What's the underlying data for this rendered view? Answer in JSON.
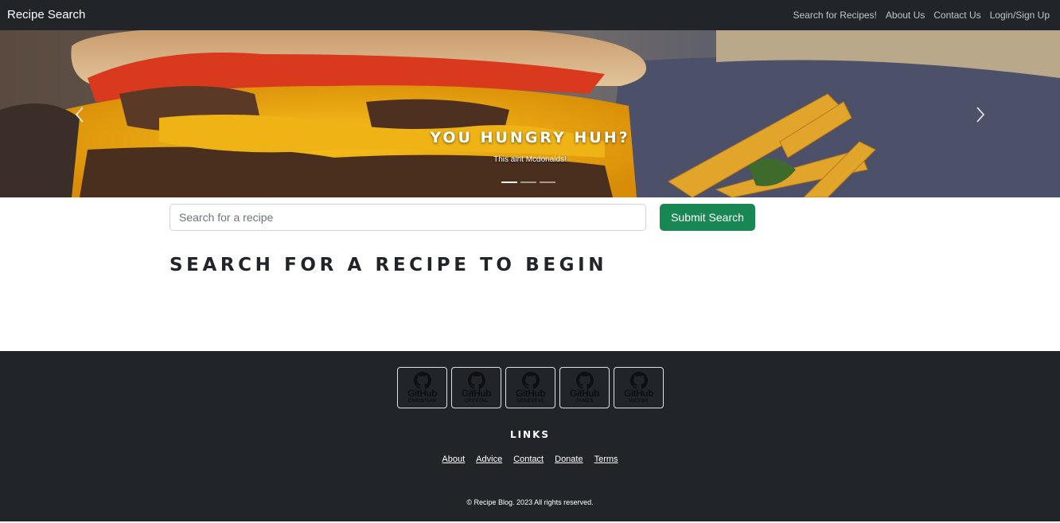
{
  "navbar": {
    "brand": "Recipe Search",
    "links": [
      {
        "label": "Search for Recipes!"
      },
      {
        "label": "About Us"
      },
      {
        "label": "Contact Us"
      },
      {
        "label": "Login/Sign Up"
      }
    ]
  },
  "carousel": {
    "caption_title": "YOU HUNGRY HUH?",
    "caption_subtitle": "This aint Mcdonalds!",
    "slides": 3,
    "active_slide": 1
  },
  "search": {
    "placeholder": "Search for a recipe",
    "value": "",
    "submit_label": "Submit Search",
    "submit_color": "#198754"
  },
  "main": {
    "heading": "SEARCH FOR A RECIPE TO BEGIN"
  },
  "footer": {
    "github_cards": [
      {
        "word": "GitHub",
        "name": "CHRISTIAN",
        "icon": "github-icon"
      },
      {
        "word": "GitHub",
        "name": "CRYSTAL",
        "icon": "github-icon"
      },
      {
        "word": "GitHub",
        "name": "GENEVEVE",
        "icon": "github-icon"
      },
      {
        "word": "GitHub",
        "name": "JAMES",
        "icon": "github-icon"
      },
      {
        "word": "GitHub",
        "name": "VICTOR",
        "icon": "github-icon"
      }
    ],
    "links_title": "LINKS",
    "links": [
      {
        "label": "About"
      },
      {
        "label": "Advice"
      },
      {
        "label": "Contact"
      },
      {
        "label": "Donate"
      },
      {
        "label": "Terms"
      }
    ],
    "copyright": "© Recipe Blog. 2023 All rights reserved."
  },
  "colors": {
    "navbar_bg": "#212529",
    "footer_bg": "#212529",
    "accent": "#198754"
  }
}
